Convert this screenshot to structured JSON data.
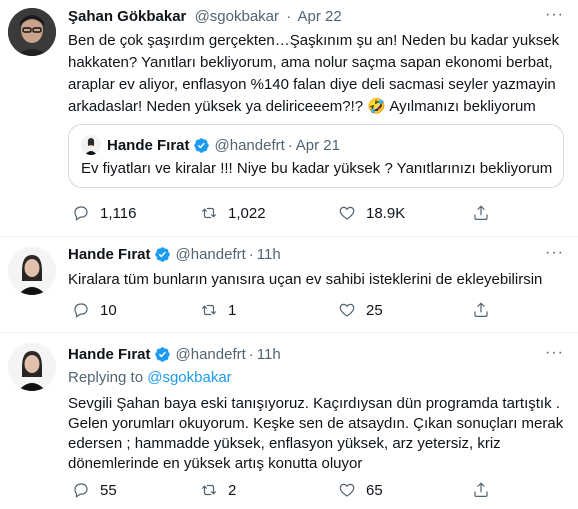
{
  "tweet1": {
    "name": "Şahan Gökbakar",
    "handle": "@sgokbakar",
    "sep": "·",
    "time": "Apr 22",
    "more": "···",
    "lines": [
      "Ben de çok şaşırdım gerçekten…Şaşkınım şu an! Neden bu kadar yuksek",
      "hakkaten? Yanıtları bekliyorum, ama nolur saçma sapan ekonomi berbat,",
      "araplar ev aliyor, enflasyon %140 falan diye deli sacmasi seyler yazmayin",
      "arkadaslar! Neden yüksek ya deliriceeem?!?"
    ],
    "emoji": "🤣",
    "after_emoji": "Ayılmanızı bekliyorum",
    "quote": {
      "name": "Hande Fırat",
      "handle": "@handefrt",
      "sep": "·",
      "time": "Apr 21",
      "text": "Ev fiyatları ve kiralar !!! Niye bu kadar yüksek ? Yanıtlarınızı bekliyorum"
    },
    "stats": {
      "replies": "1,116",
      "retweets": "1,022",
      "likes": "18.9K"
    }
  },
  "tweet2": {
    "name": "Hande Fırat",
    "handle": "@handefrt",
    "sep": "·",
    "time": "11h",
    "more": "···",
    "text": "Kiralara tüm bunların yanısıra uçan ev sahibi isteklerini de ekleyebilirsin",
    "stats": {
      "replies": "10",
      "retweets": "1",
      "likes": "25"
    }
  },
  "tweet3": {
    "name": "Hande Fırat",
    "handle": "@handefrt",
    "sep": "·",
    "time": "11h",
    "more": "···",
    "replying_to_label": "Replying to",
    "replying_to_handle": "@sgokbakar",
    "lines": [
      "Sevgili Şahan baya eski tanışıyoruz. Kaçırdıysan dün programda tartıştık .",
      "Gelen yorumları okuyorum. Keşke sen de atsaydın. Çıkan sonuçları merak",
      "edersen ; hammadde yüksek, enflasyon yüksek, arz yetersiz, kriz",
      "dönemlerinde en yüksek artış konutta oluyor"
    ],
    "stats": {
      "replies": "55",
      "retweets": "2",
      "likes": "65"
    }
  },
  "colors": {
    "accent": "#1d9bf0",
    "secondary": "#536471",
    "border": "#cfd9de"
  }
}
